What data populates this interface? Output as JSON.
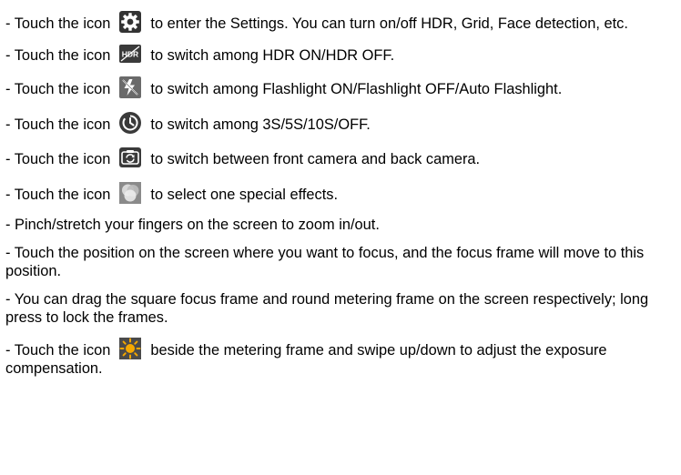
{
  "items": [
    {
      "before": "- Touch the icon",
      "icon": "settings-gear-icon",
      "after": "to enter the Settings. You can turn on/off HDR, Grid, Face detection, etc."
    },
    {
      "before": "- Touch the icon",
      "icon": "hdr-icon",
      "icon_text": "HDR",
      "after": "to switch among HDR ON/HDR OFF."
    },
    {
      "before": "- Touch the icon",
      "icon": "flash-off-icon",
      "after": "to switch among Flashlight ON/Flashlight OFF/Auto Flashlight."
    },
    {
      "before": "- Touch the icon",
      "icon": "timer-icon",
      "after": "to switch among 3S/5S/10S/OFF."
    },
    {
      "before": "- Touch the icon",
      "icon": "switch-camera-icon",
      "after": "to switch between front camera and back camera."
    },
    {
      "before": "- Touch the icon",
      "icon": "effects-icon",
      "after": "to select one special effects."
    },
    {
      "text": "- Pinch/stretch your fingers on the screen to zoom in/out."
    },
    {
      "text": "- Touch the position on the screen where you want to focus, and the focus frame will move to this position."
    },
    {
      "text": "- You can drag the square focus frame and round metering frame on the screen respectively; long press to lock the frames."
    },
    {
      "before": "- Touch the icon",
      "icon": "sun-exposure-icon",
      "after": "beside the metering frame and swipe up/down to adjust the exposure compensation."
    }
  ],
  "colors": {
    "text": "#000000",
    "icon_dark": "#3a3a3a",
    "icon_mid": "#6a6a6a",
    "sun": "#f5a800",
    "background": "#ffffff"
  }
}
